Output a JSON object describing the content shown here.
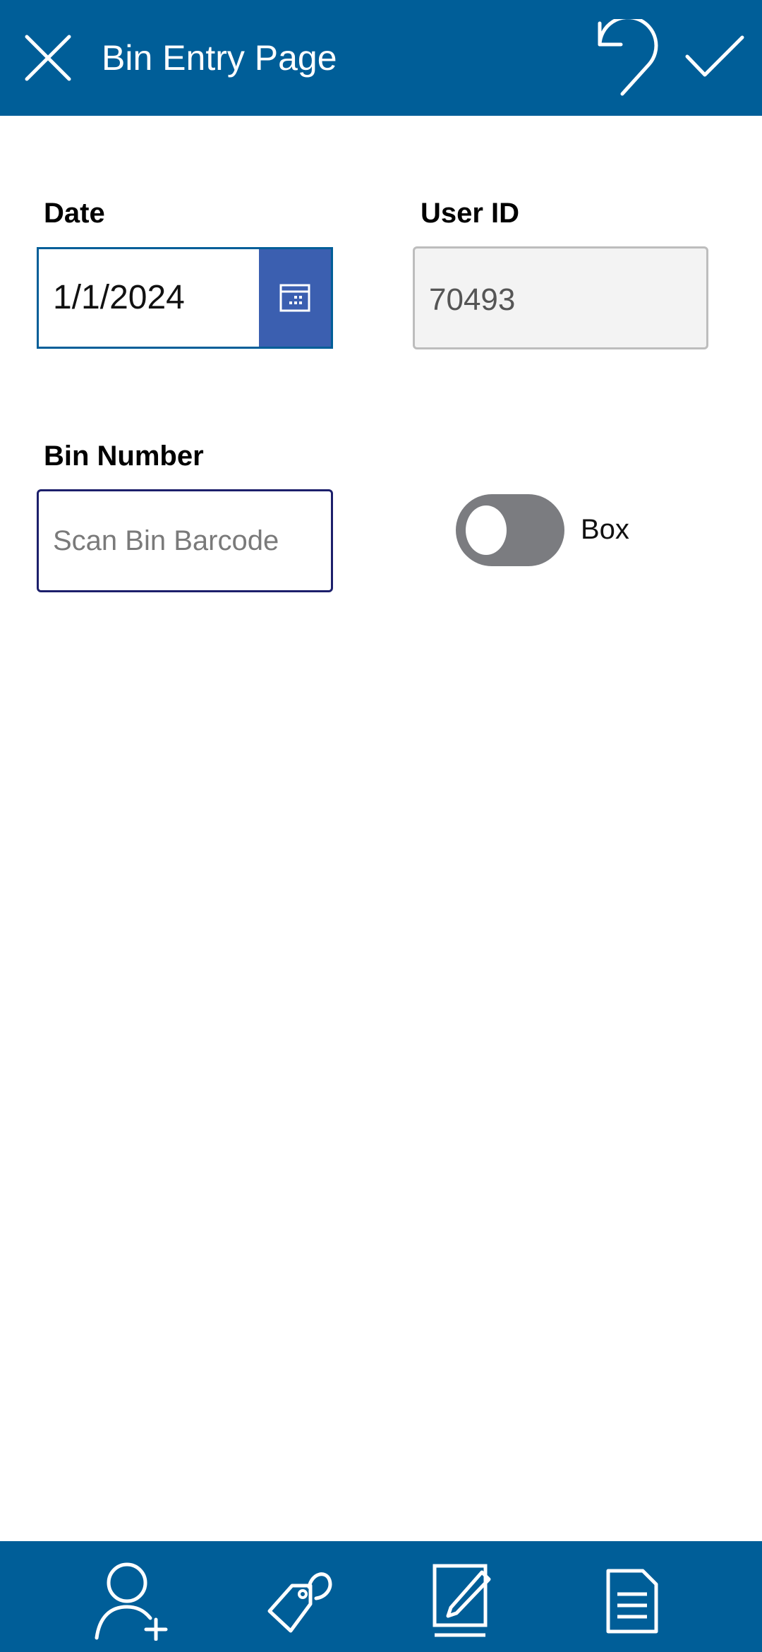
{
  "header": {
    "title": "Bin Entry Page",
    "background": "#005e98",
    "icons": [
      "close-icon",
      "undo-icon",
      "checkmark-icon"
    ]
  },
  "form": {
    "date": {
      "label": "Date",
      "value": "1/1/2024",
      "icon": "calendar-icon",
      "accent": "#3b5fb0"
    },
    "user_id": {
      "label": "User ID",
      "value": "70493"
    },
    "bin_number": {
      "label": "Bin Number",
      "placeholder": "Scan Bin Barcode",
      "value": ""
    },
    "box_toggle": {
      "label": "Box",
      "on": false
    }
  },
  "footer": {
    "icons": [
      "add-user-icon",
      "tags-icon",
      "edit-document-icon",
      "document-icon"
    ]
  }
}
